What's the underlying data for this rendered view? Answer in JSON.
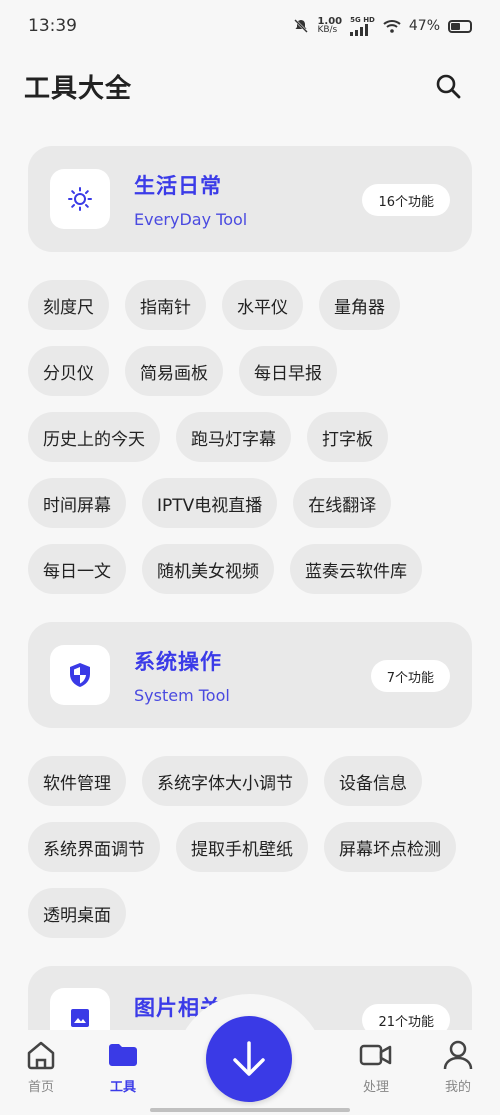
{
  "status": {
    "time": "13:39",
    "speed_value": "1.00",
    "speed_unit": "KB/s",
    "network": "5G HD",
    "battery": "47%"
  },
  "header": {
    "title": "工具大全"
  },
  "categories": [
    {
      "title": "生活日常",
      "subtitle": "EveryDay Tool",
      "count": "16个功能",
      "icon": "sun-icon",
      "tools": [
        "刻度尺",
        "指南针",
        "水平仪",
        "量角器",
        "分贝仪",
        "简易画板",
        "每日早报",
        "历史上的今天",
        "跑马灯字幕",
        "打字板",
        "时间屏幕",
        "IPTV电视直播",
        "在线翻译",
        "每日一文",
        "随机美女视频",
        "蓝奏云软件库"
      ]
    },
    {
      "title": "系统操作",
      "subtitle": "System Tool",
      "count": "7个功能",
      "icon": "shield-icon",
      "tools": [
        "软件管理",
        "系统字体大小调节",
        "设备信息",
        "系统界面调节",
        "提取手机壁纸",
        "屏幕坏点检测",
        "透明桌面"
      ]
    },
    {
      "title": "图片相关",
      "subtitle": "",
      "count": "21个功能",
      "icon": "image-icon",
      "tools": []
    }
  ],
  "nav": {
    "home": "首页",
    "tools": "工具",
    "process": "处理",
    "mine": "我的"
  },
  "colors": {
    "accent": "#3a3ae6",
    "card": "#e9e9e9",
    "background": "#f7f7f7"
  }
}
